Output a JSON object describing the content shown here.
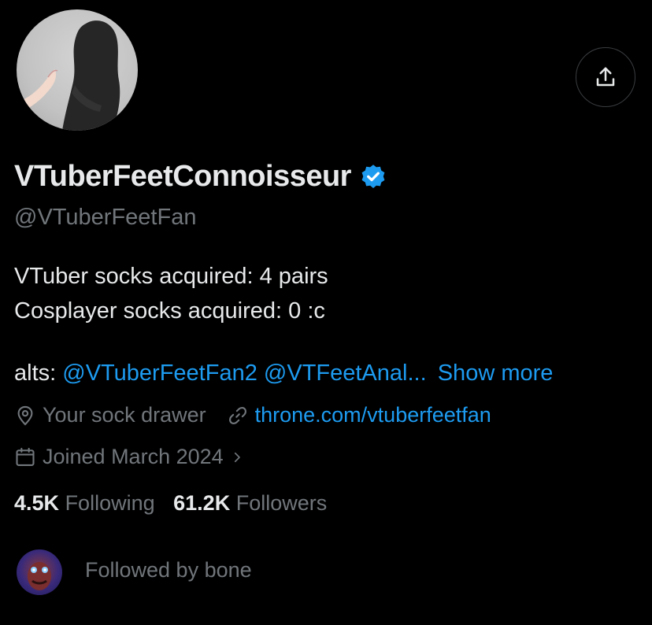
{
  "profile": {
    "display_name": "VTuberFeetConnoisseur",
    "handle": "@VTuberFeetFan",
    "verified_icon": "verified-badge-icon",
    "bio_lines": [
      "VTuber socks acquired: 4 pairs",
      "Cosplayer socks acquired: 0 :c"
    ],
    "alts_prefix": "alts:",
    "alt_1": "@VTuberFeetFan2",
    "alt_2": "@VTFeetAnal...",
    "show_more": "Show more",
    "location": "Your sock drawer",
    "website": "throne.com/vtuberfeetfan",
    "joined": "Joined March 2024",
    "following_count": "4.5K",
    "following_label": "Following",
    "followers_count": "61.2K",
    "followers_label": "Followers",
    "followed_by": "Followed by bone"
  },
  "colors": {
    "background": "#000000",
    "text_primary": "#e7e9ea",
    "text_secondary": "#71767b",
    "accent_blue": "#1d9bf0"
  }
}
